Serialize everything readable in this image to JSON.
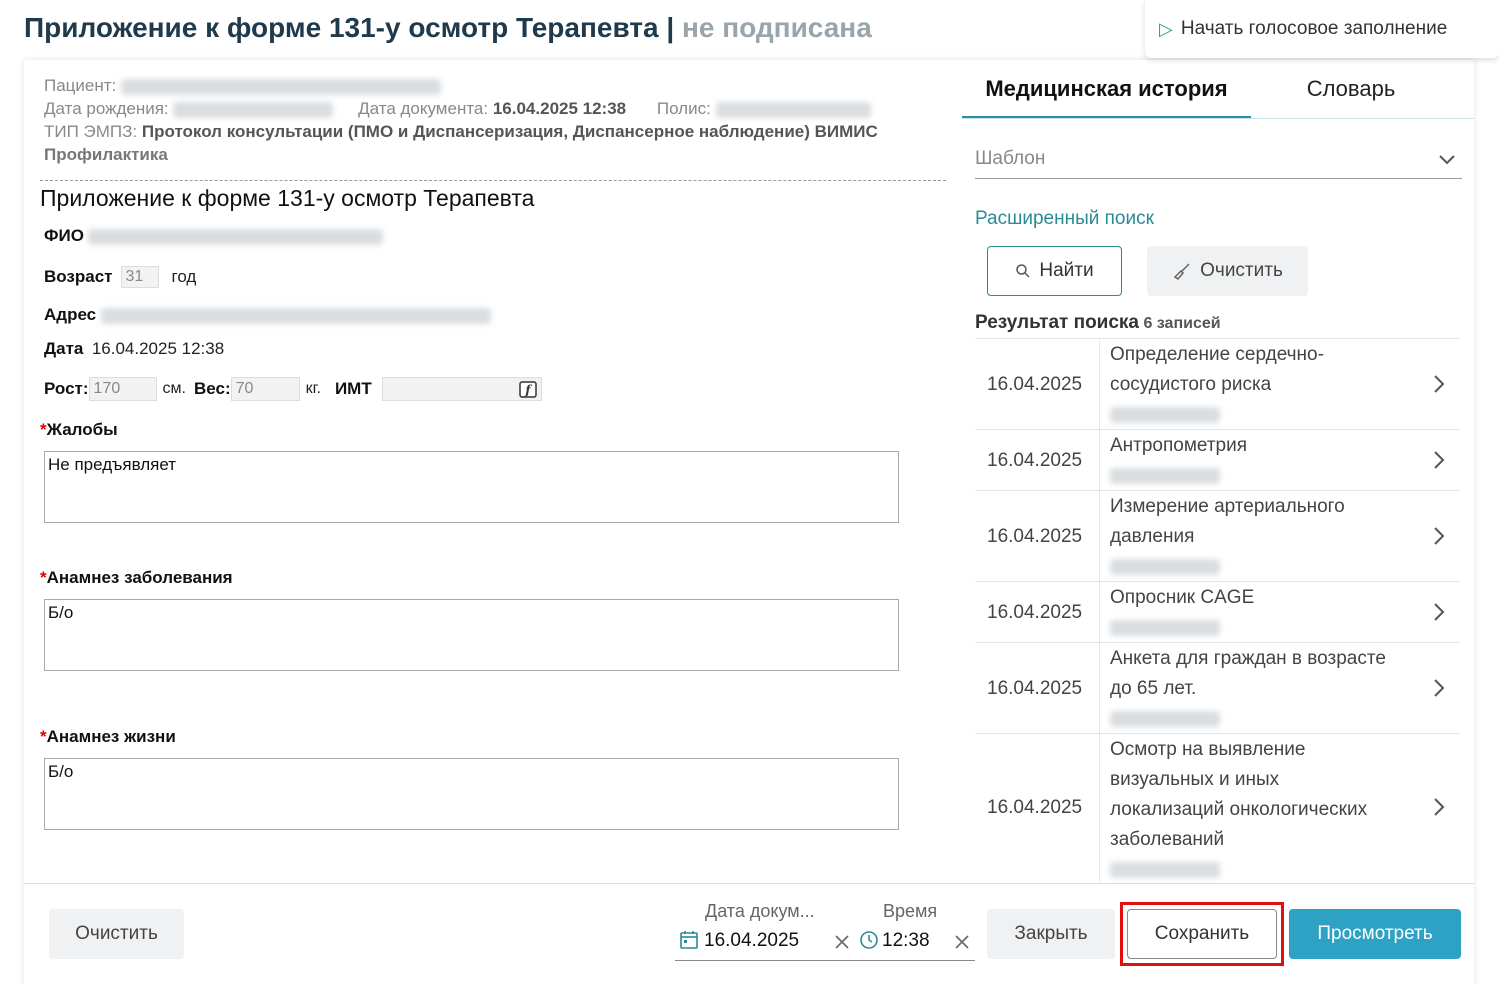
{
  "header": {
    "title": "Приложение к форме 131-у осмотр Терапевта",
    "separator": "|",
    "status": "не подписана",
    "voice_button": "Начать голосовое заполнение"
  },
  "meta": {
    "patient_label": "Пациент:",
    "dob_label": "Дата рождения:",
    "doc_date_label": "Дата документа:",
    "doc_date_value": "16.04.2025 12:38",
    "policy_label": "Полис:",
    "emp_type_label": "ТИП ЭМПЗ:",
    "emp_type_value": "Протокол консультации (ПМО и Диспансеризация, Диспансерное наблюдение) ВИМИС",
    "emp_type_value2": "Профилактика"
  },
  "form": {
    "title": "Приложение к форме 131-у осмотр Терапевта",
    "fio_label": "ФИО",
    "age_label": "Возраст",
    "age_value": "31",
    "age_unit": "год",
    "address_label": "Адрес",
    "date_label": "Дата",
    "date_value": "16.04.2025 12:38",
    "height_label": "Рост:",
    "height_value": "170",
    "height_unit": "см.",
    "weight_label": "Вес:",
    "weight_value": "70",
    "weight_unit": "кг.",
    "bmi_label": "ИМТ",
    "required_mark": "*",
    "complaints_label": "Жалобы",
    "complaints_value": "Не предъявляет",
    "anamnesis_disease_label": "Анамнез заболевания",
    "anamnesis_disease_value": "Б/о",
    "anamnesis_life_label": "Анамнез жизни",
    "anamnesis_life_value": "Б/о"
  },
  "panel": {
    "tabs": [
      "Медицинская история",
      "Словарь"
    ],
    "template_placeholder": "Шаблон",
    "advanced_search": "Расширенный поиск",
    "find_button": "Найти",
    "clear_button": "Очистить",
    "results_title": "Результат поиска",
    "results_count": "6 записей",
    "results": [
      {
        "date": "16.04.2025",
        "lines": [
          "Определение сердечно-",
          "сосудистого риска"
        ]
      },
      {
        "date": "16.04.2025",
        "lines": [
          "Антропометрия"
        ]
      },
      {
        "date": "16.04.2025",
        "lines": [
          "Измерение артериального",
          "давления"
        ]
      },
      {
        "date": "16.04.2025",
        "lines": [
          "Опросник CAGE"
        ]
      },
      {
        "date": "16.04.2025",
        "lines": [
          "Анкета для граждан в возрасте",
          "до 65 лет."
        ]
      },
      {
        "date": "16.04.2025",
        "lines": [
          "Осмотр на выявление",
          "визуальных и иных",
          "локализаций онкологических",
          "заболеваний"
        ]
      }
    ]
  },
  "footer": {
    "clear_button": "Очистить",
    "doc_date_label": "Дата докум...",
    "doc_date_value": "16.04.2025",
    "time_label": "Время",
    "time_value": "12:38",
    "close_button": "Закрыть",
    "save_button": "Сохранить",
    "view_button": "Просмотреть"
  },
  "colors": {
    "accent": "#2ea2c4",
    "link": "#2b8a94",
    "title": "#1f3a4d",
    "highlight": "#e01010"
  }
}
